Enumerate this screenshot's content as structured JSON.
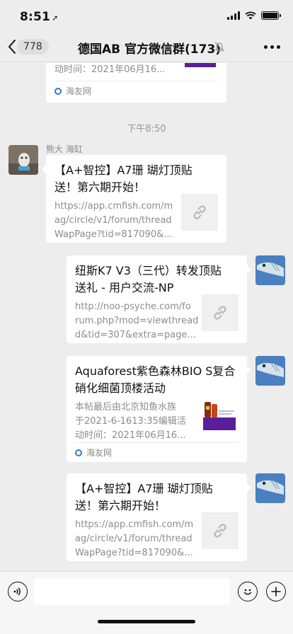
{
  "status_bar": {
    "time": "8:51"
  },
  "nav": {
    "unread_count": "778",
    "title": "德国AB 官方微信群(173)"
  },
  "messages": {
    "top_card": {
      "desc_tail": "动时间：2021年06月16...",
      "source": "海友网"
    },
    "time_separator": "下午8:50",
    "msg1": {
      "sender": "熊大 海缸",
      "title_line1": "【A+智控】A7珊 瑚灯顶贴",
      "title_line2": "送！第六期开始！",
      "desc_line1": "https://app.cmfish.com/m",
      "desc_line2": "ag/circle/v1/forum/thread",
      "desc_line3": "WapPage?tid=817090&..."
    },
    "msg2": {
      "title_line1": "纽斯K7 V3（三代）转发顶贴",
      "title_line2": "送礼 - 用户交流-NP",
      "desc_line1": "http://noo-psyche.com/fo",
      "desc_line2": "rum.php?mod=viewthread",
      "desc_line3": "d&tid=307&extra=page..."
    },
    "msg3": {
      "title_line1": "Aquaforest紫色森林BIO S复合",
      "title_line2": "硝化细菌顶楼活动",
      "desc_line1": "本帖最后由北京知鱼水族",
      "desc_line2": "于2021-6-1613:35编辑活",
      "desc_line3": "动时间：2021年06月16...",
      "source": "海友网"
    },
    "msg4": {
      "title_line1": "【A+智控】A7珊 瑚灯顶贴",
      "title_line2": "送！第六期开始！",
      "desc_line1": "https://app.cmfish.com/m",
      "desc_line2": "ag/circle/v1/forum/thread",
      "desc_line3": "WapPage?tid=817090&..."
    }
  },
  "icons": {
    "back": "chevron-left-icon",
    "mute": "bell-slash-icon",
    "more": "ellipsis-icon",
    "link": "link-icon",
    "voice": "voice-icon",
    "emoji": "emoji-icon",
    "plus": "plus-icon"
  },
  "colors": {
    "chat_bg": "#ededed",
    "bubble_bg": "#ffffff",
    "meta_text": "#8c8c8c",
    "avatar_fish": "#4a7fc0"
  }
}
